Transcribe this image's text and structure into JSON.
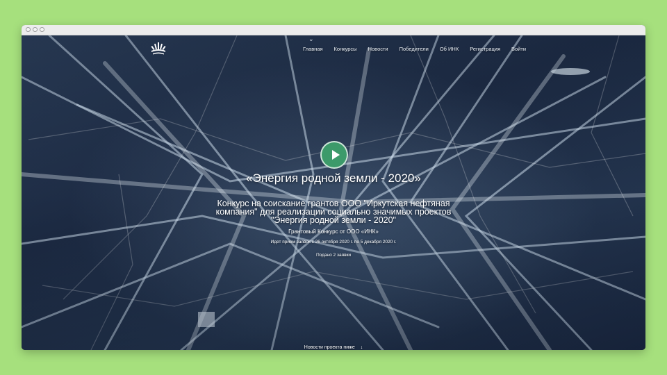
{
  "window": {
    "title": ""
  },
  "nav": {
    "items": [
      "Главная",
      "Конкурсы",
      "Новости",
      "Победители",
      "Об ИНК",
      "Регистрация",
      "Войти"
    ]
  },
  "hero": {
    "title": "«Энергия родной земли - 2020»",
    "subtitle_lines": [
      "Конкурс на соискание грантов ООО \"Иркутская нефтяная",
      "компания\" для реализации социально значимых проектов",
      "\"Энергия родной земли - 2020\""
    ],
    "grant_text": "Грантовый Конкурс от ООО «ИНК»",
    "dates_text": "Идет прием заявок с 26 октября 2020 г. по 5 декабря 2020 г.",
    "submitted_text": "Подано 2 заявки",
    "news_link": "Новости проекта ниже"
  },
  "icons": {
    "logo": "ink-logo-icon",
    "play": "play-icon",
    "chevron": "chevron-down-icon",
    "arrow": "arrow-down-icon"
  },
  "colors": {
    "background": "#a6e07d",
    "play_button": "#3c9a6a",
    "text": "#ffffff"
  }
}
